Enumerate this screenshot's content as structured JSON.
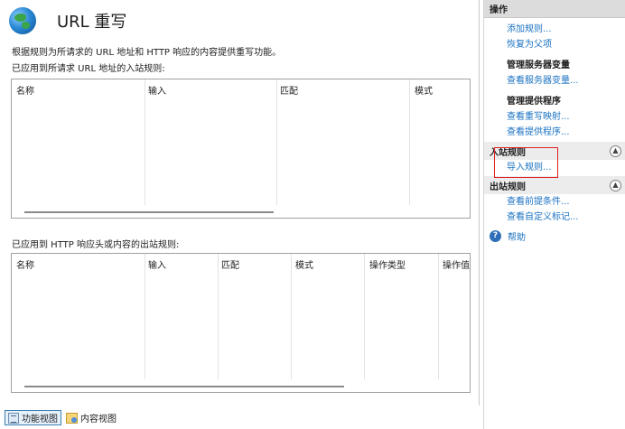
{
  "page": {
    "title": "URL 重写",
    "description": "根据规则为所请求的 URL 地址和 HTTP 响应的内容提供重写功能。",
    "inbound_label": "已应用到所请求 URL 地址的入站规则:",
    "outbound_label": "已应用到 HTTP 响应头或内容的出站规则:"
  },
  "inbound_table": {
    "columns": [
      "名称",
      "输入",
      "匹配",
      "模式"
    ]
  },
  "outbound_table": {
    "columns": [
      "名称",
      "输入",
      "匹配",
      "模式",
      "操作类型",
      "操作值"
    ]
  },
  "footer": {
    "feature_view": "功能视图",
    "content_view": "内容视图"
  },
  "actions": {
    "header": "操作",
    "add_rule": "添加规则...",
    "revert_parent": "恢复为父项",
    "server_vars_title": "管理服务器变量",
    "view_server_vars": "查看服务器变量...",
    "providers_title": "管理提供程序",
    "view_rewrite_maps": "查看重写映射...",
    "view_providers": "查看提供程序...",
    "inbound_section": "入站规则",
    "import_rules": "导入规则...",
    "outbound_section": "出站规则",
    "view_preconditions": "查看前提条件...",
    "view_custom_tags": "查看自定义标记...",
    "help": "帮助"
  },
  "colors": {
    "link": "#1a72c2",
    "highlight": "#e02020",
    "action_header_bg": "#dcdcdc"
  }
}
